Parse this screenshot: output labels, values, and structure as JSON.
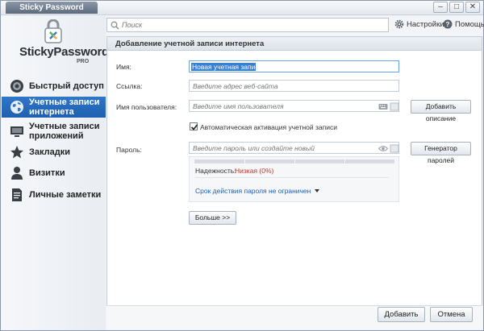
{
  "app": {
    "title": "Sticky Password"
  },
  "window_buttons": {
    "minimize": "–",
    "maximize": "□",
    "close": "✕"
  },
  "logo": {
    "name": "StickyPassword",
    "edition": "PRO"
  },
  "sidebar": {
    "items": [
      {
        "label": "Быстрый доступ",
        "icon": "target-icon",
        "active": false
      },
      {
        "label": "Учетные записи интернета",
        "icon": "globe-icon",
        "active": true
      },
      {
        "label": "Учетные записи приложений",
        "icon": "monitor-icon",
        "active": false
      },
      {
        "label": "Закладки",
        "icon": "star-icon",
        "active": false
      },
      {
        "label": "Визитки",
        "icon": "person-icon",
        "active": false
      },
      {
        "label": "Личные заметки",
        "icon": "note-icon",
        "active": false
      }
    ]
  },
  "search": {
    "placeholder": "Поиск",
    "value": ""
  },
  "toolbar": {
    "settings_label": "Настройки",
    "help_label": "Помощь"
  },
  "form": {
    "title": "Добавление учетной записи интернета",
    "name_label": "Имя:",
    "name_value": "Новая учетная запись",
    "link_label": "Ссылка:",
    "link_placeholder": "Введите адрес веб-сайта",
    "username_label": "Имя пользователя:",
    "username_placeholder": "Введите имя пользователя",
    "add_description_button": "Добавить описание",
    "auto_login_label": "Автоматическая активация учетной записи",
    "auto_login_checked": true,
    "password_label": "Пароль:",
    "password_placeholder": "Введите пароль или создайте новый",
    "generator_button": "Генератор паролей",
    "strength_label": "Надежность:",
    "strength_value": "Низкая (0%)",
    "strength_color": "#c0392b",
    "expiry_text": "Срок действия пароля не ограничен",
    "more_button": "Больше >>"
  },
  "footer": {
    "add_button": "Добавить",
    "cancel_button": "Отмена"
  },
  "colors": {
    "accent": "#2f77c9",
    "link": "#1f5faf"
  }
}
